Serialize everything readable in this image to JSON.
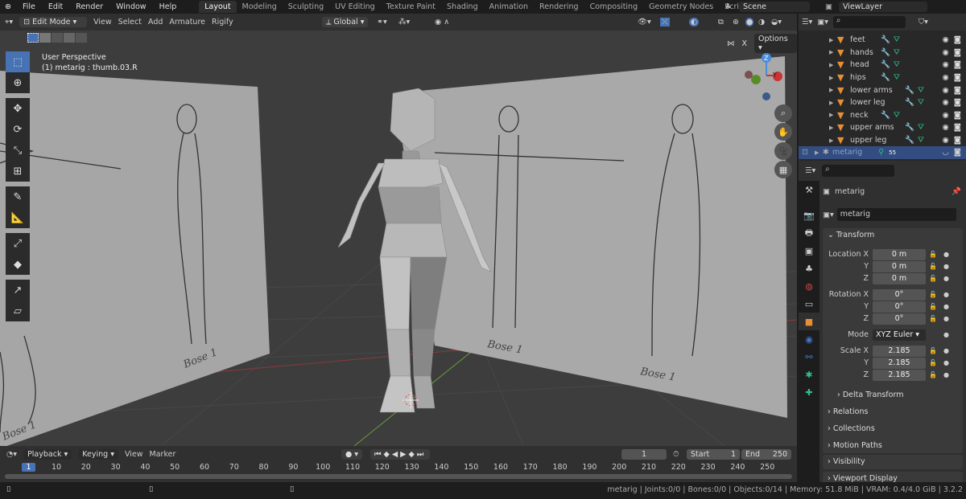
{
  "topbar": {
    "menus": [
      "File",
      "Edit",
      "Render",
      "Window",
      "Help"
    ],
    "workspaces": [
      "Layout",
      "Modeling",
      "Sculpting",
      "UV Editing",
      "Texture Paint",
      "Shading",
      "Animation",
      "Rendering",
      "Compositing",
      "Geometry Nodes",
      "Scripting"
    ],
    "active_workspace": "Layout",
    "add": "+",
    "scene": "Scene",
    "view_layer": "ViewLayer"
  },
  "viewport_header": {
    "mode": "Edit Mode",
    "menus": [
      "View",
      "Select",
      "Add",
      "Armature",
      "Rigify"
    ],
    "orientation": "Global",
    "options": "Options",
    "x_mirror": "X"
  },
  "viewport": {
    "perspective": "User Perspective",
    "active": "(1) metarig : thumb.03.R",
    "axis_labels": [
      "Z",
      "Y"
    ],
    "sketch_label": "Bose 1"
  },
  "outliner": {
    "items": [
      {
        "name": "feet"
      },
      {
        "name": "hands"
      },
      {
        "name": "head"
      },
      {
        "name": "hips"
      },
      {
        "name": "lower arms"
      },
      {
        "name": "lower leg"
      },
      {
        "name": "neck"
      },
      {
        "name": "upper arms"
      },
      {
        "name": "upper leg"
      }
    ],
    "selected": "metarig",
    "selected_badge": "55"
  },
  "properties": {
    "object_name": "metarig",
    "data_name": "metarig",
    "transform": "Transform",
    "location_label": "Location X",
    "rotation_label": "Rotation X",
    "scale_label": "Scale X",
    "y": "Y",
    "z": "Z",
    "location": [
      "0 m",
      "0 m",
      "0 m"
    ],
    "rotation": [
      "0°",
      "0°",
      "0°"
    ],
    "mode_label": "Mode",
    "mode": "XYZ Euler",
    "scale": [
      "2.185",
      "2.185",
      "2.185"
    ],
    "delta": "Delta Transform",
    "sections": [
      "Relations",
      "Collections",
      "Motion Paths",
      "Visibility",
      "Viewport Display"
    ]
  },
  "timeline": {
    "menus": [
      "Playback",
      "Keying",
      "View",
      "Marker"
    ],
    "current_frame": "1",
    "start_label": "Start",
    "start": "1",
    "end_label": "End",
    "end": "250",
    "ticks": [
      "10",
      "20",
      "30",
      "40",
      "50",
      "60",
      "70",
      "80",
      "90",
      "100",
      "110",
      "120",
      "130",
      "140",
      "150",
      "160",
      "170",
      "180",
      "190",
      "200",
      "210",
      "220",
      "230",
      "240",
      "250"
    ]
  },
  "status": {
    "text": "metarig | Joints:0/0 | Bones:0/0 | Objects:0/14 | Memory: 51.8 MiB | VRAM: 0.4/4.0 GiB | 3.2.2"
  },
  "colors": {
    "accent": "#4772b3",
    "mesh": "#e78f34",
    "modifier": "#6b8de0",
    "vertex_group": "#2fbf8a"
  }
}
